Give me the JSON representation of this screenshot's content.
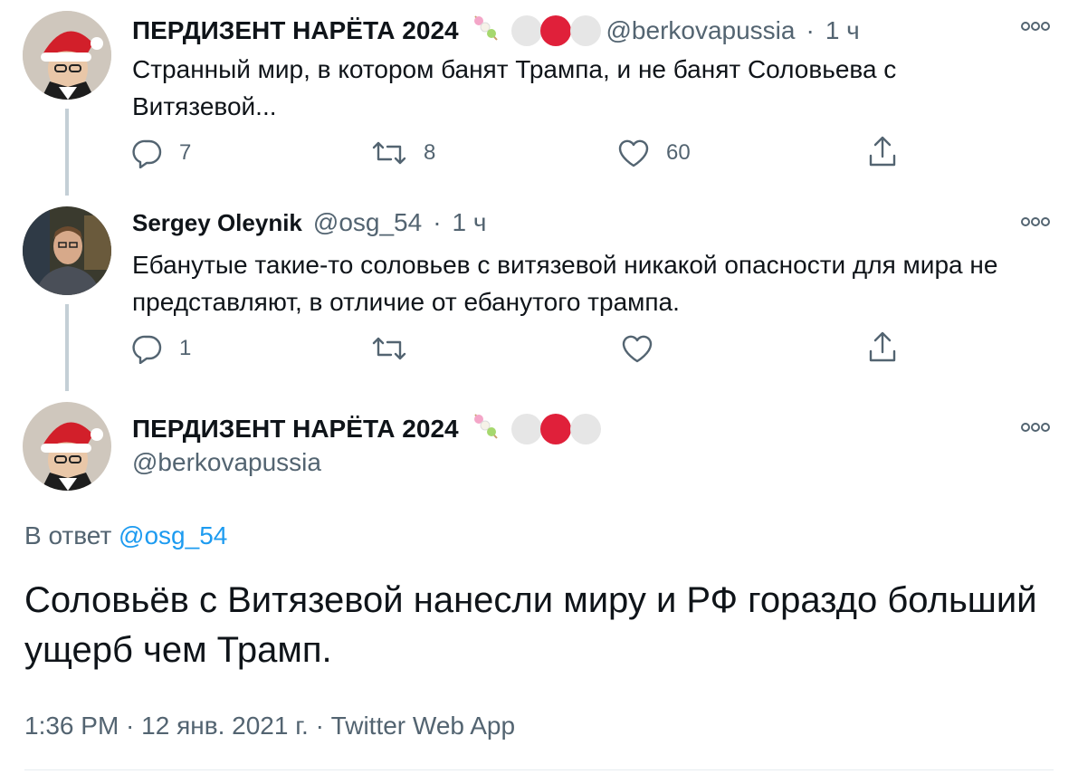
{
  "tweets": [
    {
      "name": "ПЕРДИЗЕНТ НАРЁТА 2024",
      "handle": "@berkovapussia",
      "sep": "·",
      "time": "1 ч",
      "text": "Странный мир, в котором банят Трампа, и не банят Соловьева с Витязевой...",
      "replies": "7",
      "retweets": "8",
      "likes": "60"
    },
    {
      "name": "Sergey Oleynik",
      "handle": "@osg_54",
      "sep": "·",
      "time": "1 ч",
      "text": "Ебанутые такие-то соловьев с витязевой никакой опасности для мира не представляют, в отличие от ебанутого трампа.",
      "replies": "1",
      "retweets": "",
      "likes": ""
    }
  ],
  "main_tweet": {
    "name": "ПЕРДИЗЕНТ НАРЁТА 2024",
    "handle": "@berkovapussia",
    "reply_prefix": "В ответ",
    "reply_to": "@osg_54",
    "text": "Соловьёв с Витязевой нанесли миру и РФ гораздо больший ущерб чем Трамп.",
    "meta": "1:36 PM · 12 янв. 2021 г. · Twitter Web App"
  },
  "colors": {
    "link": "#1d9bf0",
    "muted": "#536471",
    "badge_red": "#e0203a",
    "badge_grey": "#e6e6e6"
  }
}
